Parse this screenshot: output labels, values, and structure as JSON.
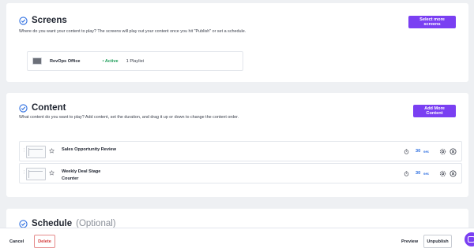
{
  "screens": {
    "title": "Screens",
    "description": "Where do you want your content to play? The screens will play out your content once you hit \"Publish\" or set a schedule.",
    "action_label": "Select more screens",
    "items": [
      {
        "name": "RevOps Office",
        "status": "• Active",
        "playlist": "1 Playlist"
      }
    ]
  },
  "content": {
    "title": "Content",
    "description": "What content do you want to play? Add content, set the duration, and drag it up or down to change the content order.",
    "action_label": "Add More Content",
    "items": [
      {
        "title": "Sales Opportunity Review",
        "duration": "30",
        "unit": "sec"
      },
      {
        "title": "Weekly Deal Stage Counter",
        "duration": "30",
        "unit": "sec"
      }
    ]
  },
  "schedule": {
    "title": "Schedule",
    "optional_label": "(Optional)"
  },
  "footer": {
    "cancel_label": "Cancel",
    "delete_label": "Delete",
    "preview_label": "Preview",
    "unpublish_label": "Unpublish"
  },
  "colors": {
    "accent": "#7a3ff2",
    "active": "#1f9e5a",
    "danger": "#d33c3c",
    "duration": "#2b6de0"
  },
  "icons": [
    "check-circle-icon",
    "drag-handle-icon",
    "star-icon",
    "timer-icon",
    "gear-icon",
    "close-icon",
    "chat-icon"
  ]
}
